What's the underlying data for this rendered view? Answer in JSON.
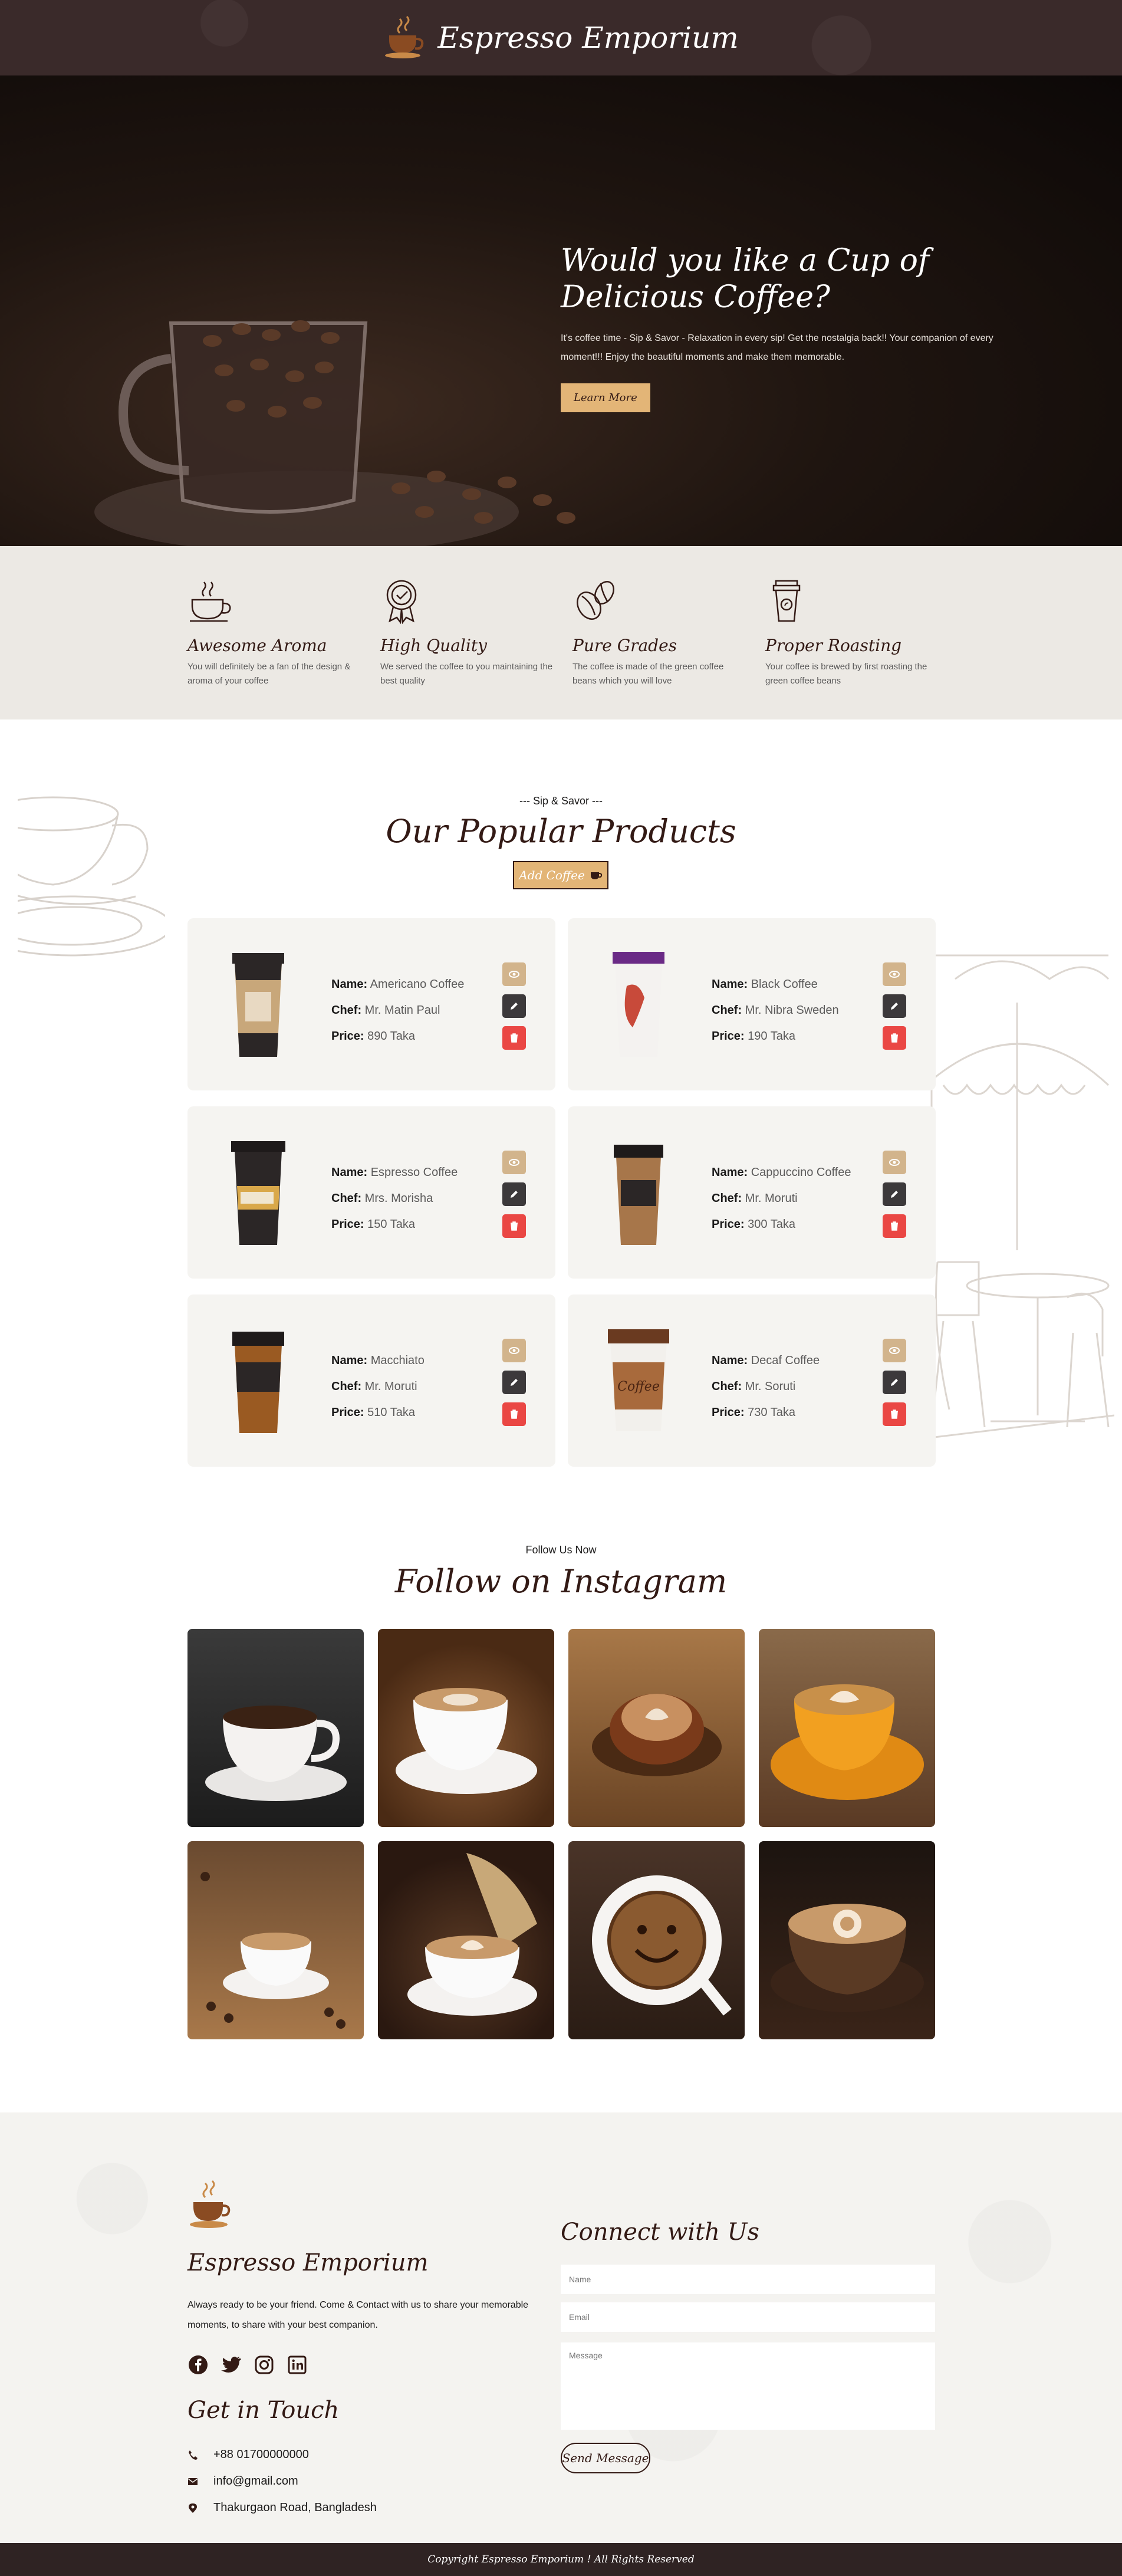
{
  "header": {
    "title": "Espresso Emporium"
  },
  "hero": {
    "headline": "Would you like a Cup of Delicious Coffee?",
    "body": "It's coffee time - Sip & Savor - Relaxation in every sip! Get the nostalgia back!! Your companion of every moment!!! Enjoy the beautiful moments and make them memorable.",
    "cta": "Learn More"
  },
  "features": [
    {
      "icon": "coffee-cup-icon",
      "title": "Awesome Aroma",
      "text": "You will definitely be a fan of the design & aroma of your coffee"
    },
    {
      "icon": "quality-badge-icon",
      "title": "High Quality",
      "text": "We served the coffee to you maintaining the best quality"
    },
    {
      "icon": "coffee-beans-icon",
      "title": "Pure Grades",
      "text": "The coffee is made of the green coffee beans which you will love"
    },
    {
      "icon": "takeaway-cup-icon",
      "title": "Proper Roasting",
      "text": "Your coffee is brewed by first roasting the green coffee beans"
    }
  ],
  "products": {
    "kicker": "--- Sip & Savor ---",
    "title": "Our Popular Products",
    "add_button": "Add Coffee",
    "labels": {
      "name": "Name:",
      "chef": "Chef:",
      "price": "Price:"
    },
    "items": [
      {
        "name": "Americano Coffee",
        "chef": "Mr. Matin Paul",
        "price": "890 Taka"
      },
      {
        "name": "Black Coffee",
        "chef": "Mr. Nibra Sweden",
        "price": "190 Taka"
      },
      {
        "name": "Espresso Coffee",
        "chef": "Mrs. Morisha",
        "price": "150 Taka"
      },
      {
        "name": "Cappuccino Coffee",
        "chef": "Mr. Moruti",
        "price": "300 Taka"
      },
      {
        "name": "Macchiato",
        "chef": "Mr. Moruti",
        "price": "510 Taka"
      },
      {
        "name": "Decaf Coffee",
        "chef": "Mr. Soruti",
        "price": "730 Taka"
      }
    ]
  },
  "instagram": {
    "kicker": "Follow Us Now",
    "title": "Follow on Instagram"
  },
  "footer": {
    "brand": "Espresso Emporium",
    "description": "Always ready to be your friend. Come & Contact with us to share your memorable moments, to share with your best companion.",
    "get_in_touch": "Get in Touch",
    "phone": "+88 01700000000",
    "email": "info@gmail.com",
    "address": "Thakurgaon Road, Bangladesh",
    "connect_title": "Connect with Us",
    "name_placeholder": "Name",
    "email_placeholder": "Email",
    "message_placeholder": "Message",
    "send_button": "Send Message",
    "copyright": "Copyright Espresso Emporium ! All Rights Reserved"
  },
  "colors": {
    "brown_dark": "#331a15",
    "tan_accent": "#e3b577",
    "view_button": "#d2b48c",
    "edit_button": "#3c393b",
    "delete_button": "#ea4744",
    "card_bg": "#f5f4f1"
  }
}
